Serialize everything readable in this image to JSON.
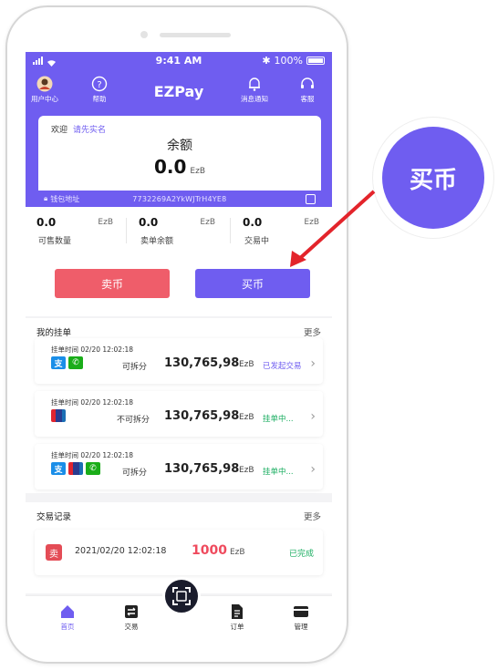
{
  "status_bar": {
    "time": "9:41 AM",
    "battery": "100%"
  },
  "header": {
    "title": "EZPay",
    "user_center": "用户中心",
    "help": "帮助",
    "notifications": "消息通知",
    "service": "客服"
  },
  "balance": {
    "welcome": "欢迎",
    "verify_link": "请先实名",
    "label": "余额",
    "value": "0.0",
    "unit": "EzB",
    "wallet_label": "钱包地址",
    "wallet_address": "7732269A2YkWJTrH4YE8"
  },
  "stats": [
    {
      "value": "0.0",
      "unit": "EzB",
      "label": "可售数量"
    },
    {
      "value": "0.0",
      "unit": "EzB",
      "label": "卖单余额"
    },
    {
      "value": "0.0",
      "unit": "EzB",
      "label": "交易中"
    }
  ],
  "actions": {
    "sell": "卖币",
    "buy": "买币"
  },
  "my_orders": {
    "title": "我的挂单",
    "more": "更多",
    "items": [
      {
        "time": "挂单时间 02/20  12:02:18",
        "split": "可拆分",
        "amount": "130,765,98",
        "unit": "EzB",
        "status": "已发起交易",
        "status_color": "#6f5df0"
      },
      {
        "time": "挂单时间 02/20  12:02:18",
        "split": "不可拆分",
        "amount": "130,765,98",
        "unit": "EzB",
        "status": "挂单中...",
        "status_color": "#1aad60"
      },
      {
        "time": "挂单时间 02/20  12:02:18",
        "split": "可拆分",
        "amount": "130,765,98",
        "unit": "EzB",
        "status": "挂单中...",
        "status_color": "#1aad60"
      }
    ]
  },
  "trade_records": {
    "title": "交易记录",
    "more": "更多",
    "item": {
      "tag": "卖",
      "time": "2021/02/20 12:02:18",
      "amount": "1000",
      "unit": "EzB",
      "status": "已完成"
    }
  },
  "tabs": {
    "home": "首页",
    "trade": "交易",
    "orders": "订单",
    "manage": "管理"
  },
  "callout": {
    "label": "买币"
  },
  "colors": {
    "accent": "#6f5df0",
    "sell": "#ef5d6a",
    "success": "#1aad60"
  }
}
